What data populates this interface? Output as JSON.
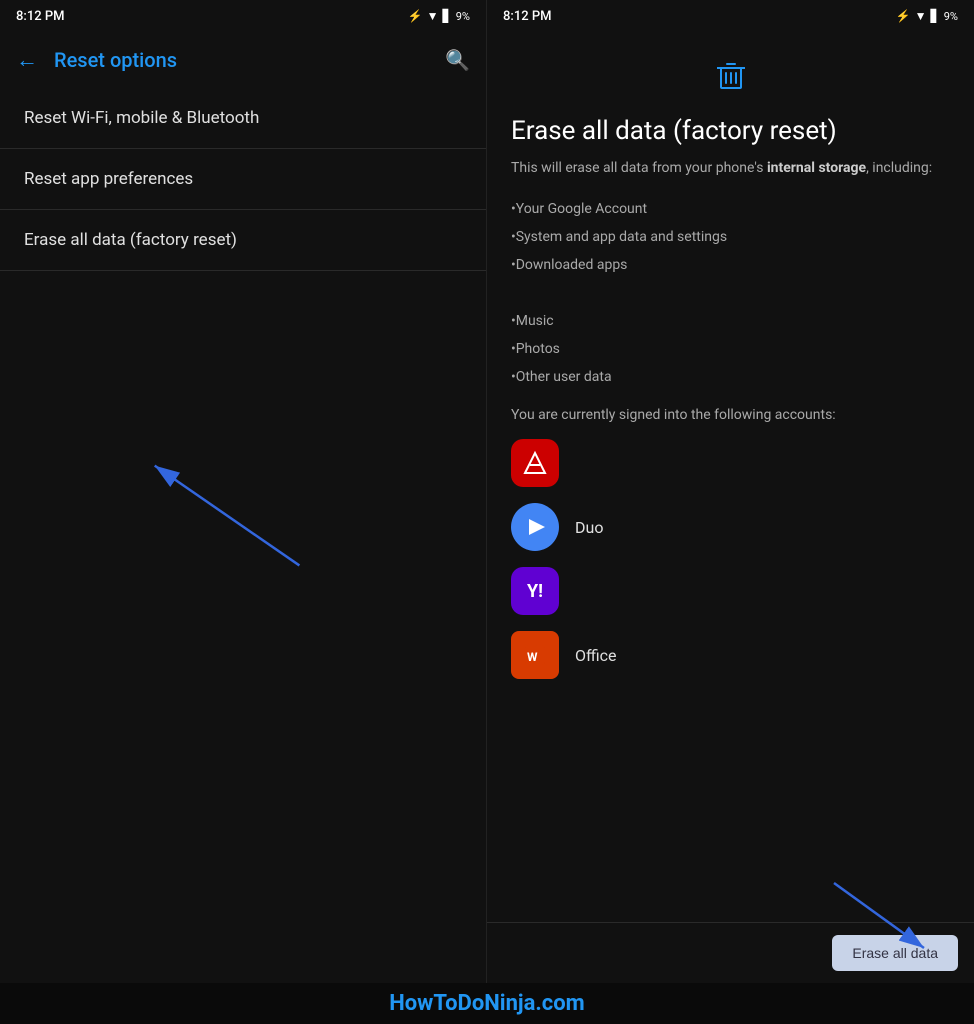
{
  "left_status": {
    "time": "8:12 PM",
    "battery": "9%"
  },
  "right_status": {
    "time": "8:12 PM",
    "battery": "9%"
  },
  "left_panel": {
    "title": "Reset options",
    "back_label": "←",
    "search_icon": "search",
    "menu_items": [
      {
        "id": "reset-wifi",
        "label": "Reset Wi-Fi, mobile & Bluetooth"
      },
      {
        "id": "reset-app",
        "label": "Reset app preferences"
      },
      {
        "id": "erase-data",
        "label": "Erase all data (factory reset)"
      }
    ]
  },
  "right_panel": {
    "trash_icon": "🗑",
    "title": "Erase all data (factory reset)",
    "description_plain": "This will erase all data from your phone's ",
    "description_bold": "internal storage",
    "description_suffix": ", including:",
    "bullets": [
      "•Your Google Account",
      "•System and app data and settings",
      "•Downloaded apps",
      "•Music",
      "•Photos",
      "•Other user data"
    ],
    "accounts_label": "You are currently signed into the following accounts:",
    "accounts": [
      {
        "id": "adobe",
        "color": "#CC0000",
        "icon_text": "A",
        "label": ""
      },
      {
        "id": "duo",
        "color": "#4285F4",
        "icon_text": "▶",
        "label": "Duo"
      },
      {
        "id": "yahoo",
        "color": "#6001D2",
        "icon_text": "Y!",
        "label": ""
      },
      {
        "id": "office",
        "color": "#D83B01",
        "icon_text": "⬡",
        "label": "Office"
      }
    ],
    "erase_button_label": "Erase all data"
  },
  "watermark": "HowToDoNinja.com"
}
